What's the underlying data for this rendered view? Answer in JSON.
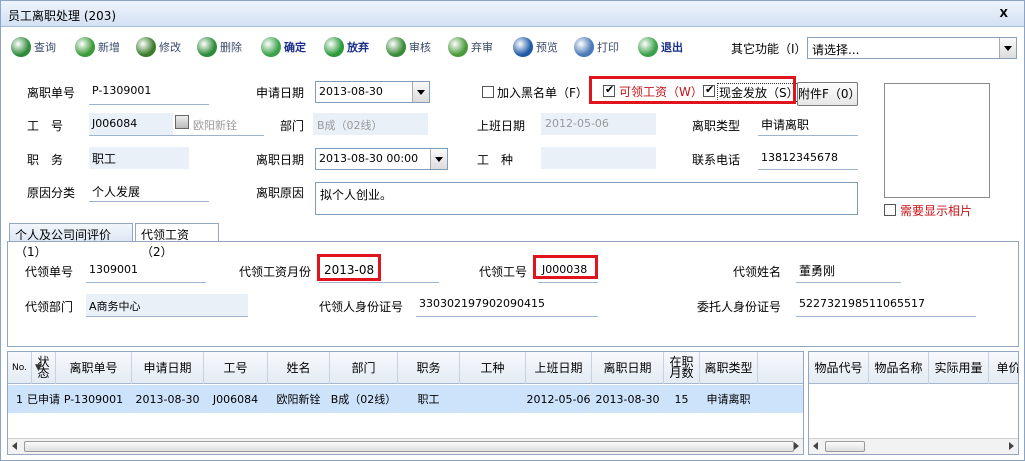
{
  "window": {
    "title": "员工离职处理 (203)",
    "close_label": "X"
  },
  "toolbar": {
    "items": [
      {
        "label": "查询",
        "icon": "search-icon",
        "color": "#2e8b3a"
      },
      {
        "label": "新增",
        "icon": "add-icon",
        "color": "#3a9a3a"
      },
      {
        "label": "修改",
        "icon": "edit-icon",
        "color": "#3a7a2a"
      },
      {
        "label": "删除",
        "icon": "delete-icon",
        "color": "#2e8b3a"
      },
      {
        "label": "确定",
        "icon": "confirm-icon",
        "color": "#3ba24a"
      },
      {
        "label": "放弃",
        "icon": "discard-icon",
        "color": "#2a9a3a"
      },
      {
        "label": "审核",
        "icon": "approve-icon",
        "color": "#3a8a3a"
      },
      {
        "label": "弃审",
        "icon": "unapprove-icon",
        "color": "#4a9a3a"
      },
      {
        "label": "预览",
        "icon": "preview-icon",
        "color": "#1f5aa8"
      },
      {
        "label": "打印",
        "icon": "print-icon",
        "color": "#4a78b8"
      },
      {
        "label": "退出",
        "icon": "exit-icon",
        "color": "#3aa04a"
      }
    ],
    "other_functions_label": "其它功能（I）:",
    "other_functions_value": "请选择..."
  },
  "form": {
    "lizhi_danhao_label": "离职单号",
    "lizhi_danhao": "P-1309001",
    "shenqing_riqi_label": "申请日期",
    "shenqing_riqi": "2013-08-30",
    "blacklist_label": "加入黑名单（F）",
    "kelinggongzi_label": "可领工资（W）",
    "xianjin_label": "现金发放（S）",
    "attachment_label": "附件F（0）",
    "gonghao_label": "工　号",
    "gonghao": "J006084",
    "xingming": "欧阳新铨",
    "bumen_label": "部门",
    "bumen": "B成（02线）",
    "shangban_label": "上班日期",
    "shangban": "2012-05-06",
    "lizhileixing_label": "离职类型",
    "lizhileixing": "申请离职",
    "zhiwu_label": "职　务",
    "zhiwu": "职工",
    "lizhiriqi_label": "离职日期",
    "lizhiriqi": "2013-08-30 00:00",
    "gongzhong_label": "工　种",
    "gongzhong": "",
    "dianhua_label": "联系电话",
    "dianhua": "13812345678",
    "yuanyin_fenlei_label": "原因分类",
    "yuanyin_fenlei": "个人发展",
    "lizhi_yuanyin_label": "离职原因",
    "lizhi_yuanyin": "拟个人创业。",
    "photo_label": "需要显示相片"
  },
  "tabs": [
    {
      "label": "个人及公司间评价（1）"
    },
    {
      "label": "代领工资（2）"
    }
  ],
  "proxy": {
    "danhao_label": "代领单号",
    "danhao": "1309001",
    "yuefen_label": "代领工资月份",
    "yuefen": "2013-08",
    "gonghao_label": "代领工号",
    "gonghao": "J000038",
    "xingming_label": "代领姓名",
    "xingming": "董勇刚",
    "bumen_label": "代领部门",
    "bumen": "A商务中心",
    "shenfenzheng_label": "代领人身份证号",
    "shenfenzheng": "330302197902090415",
    "weituoren_label": "委托人身份证号",
    "weituoren": "522732198511065517"
  },
  "grid": {
    "headers": [
      "No.",
      "状态",
      "离职单号",
      "申请日期",
      "工号",
      "姓名",
      "部门",
      "职务",
      "工种",
      "上班日期",
      "离职日期",
      "在职月数",
      "离职类型"
    ],
    "rows": [
      [
        "1",
        "已申请",
        "P-1309001",
        "2013-08-30",
        "J006084",
        "欧阳新铨",
        "B成（02线）",
        "职工",
        "",
        "2012-05-06",
        "2013-08-30",
        "15",
        "申请离职"
      ]
    ]
  },
  "grid2": {
    "headers": [
      "物品代号",
      "物品名称",
      "实际用量",
      "单价"
    ]
  },
  "colors": {
    "highlight_red": "#e0141c",
    "selected_row": "#cde3fb",
    "header_bg": "#e4ebf4"
  }
}
